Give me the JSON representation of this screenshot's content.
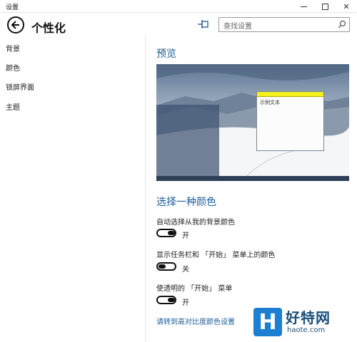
{
  "window": {
    "title": "设置",
    "minimize_icon": "minimize-icon",
    "maximize_icon": "maximize-icon",
    "close_glyph": "✕"
  },
  "header": {
    "title": "个性化",
    "back_icon": "back-arrow-icon",
    "pin_icon": "pin-icon",
    "search_placeholder": "查找设置",
    "search_icon": "search-icon"
  },
  "sidebar": {
    "items": [
      {
        "label": "背景"
      },
      {
        "label": "颜色"
      },
      {
        "label": "锁屏界面"
      },
      {
        "label": "主题"
      }
    ]
  },
  "main": {
    "preview_title": "预览",
    "preview_sample_text": "示例文本",
    "color_section_title": "选择一种颜色",
    "options": [
      {
        "label": "自动选择从我的背景颜色",
        "state": "开",
        "on": true
      },
      {
        "label": "显示任务栏和 「开始」 菜单上的颜色",
        "state": "关",
        "on": false
      },
      {
        "label": "使透明的 「开始」 菜单",
        "state": "开",
        "on": true
      }
    ],
    "high_contrast_link": "请转到高对比度颜色设置"
  },
  "colors": {
    "accent": "#1a5f9a",
    "sample_titlebar": "#f4ef1d",
    "watermark": "#1c7fd1"
  },
  "watermark": {
    "logo_letter": "H",
    "title": "好特网",
    "url": "haote.com"
  }
}
